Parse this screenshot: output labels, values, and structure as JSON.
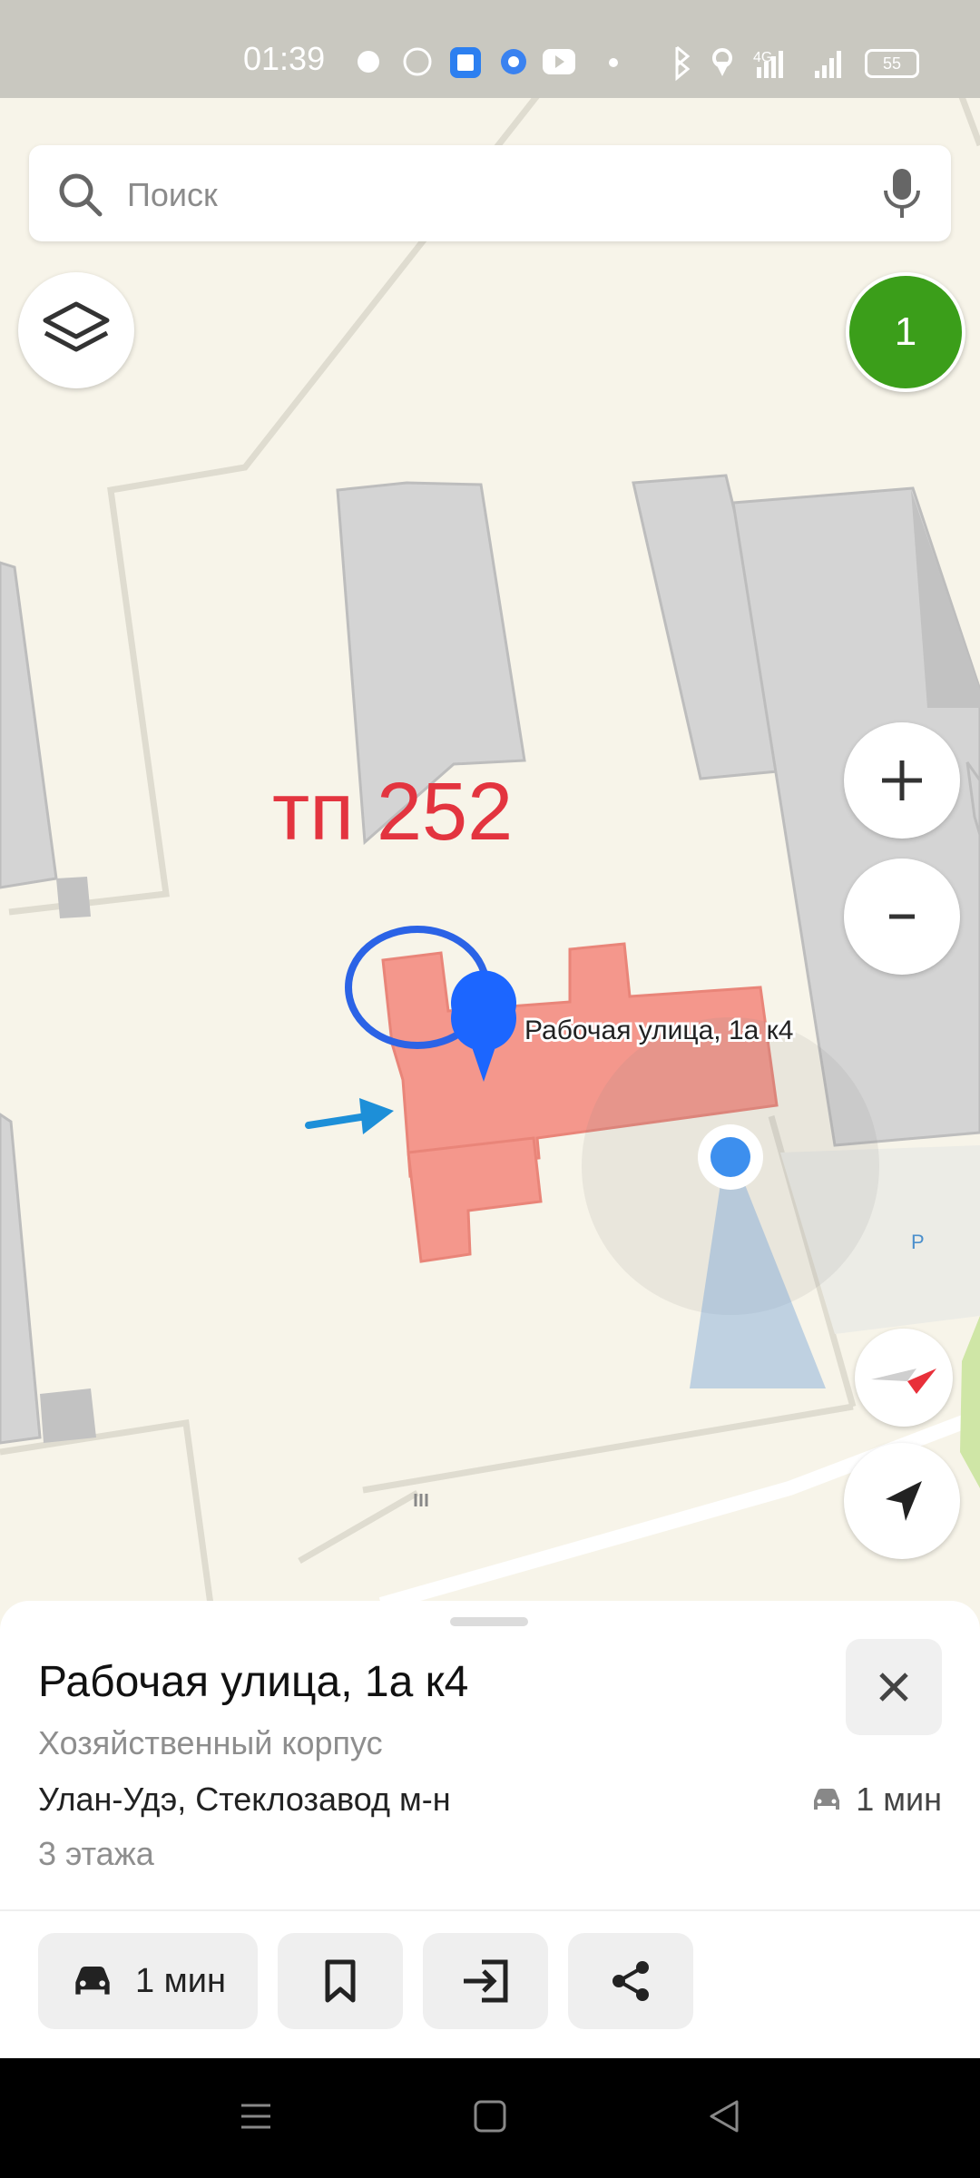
{
  "status_bar": {
    "time": "01:39",
    "network": "4G",
    "battery": "55"
  },
  "search": {
    "placeholder": "Поиск"
  },
  "notification_badge": "1",
  "map": {
    "annotation_text": "тп 252",
    "pin_label": "Рабочая улица, 1а к4",
    "parking_label": "P",
    "colors": {
      "selected_building": "#f4978c",
      "building": "#d4d4d4",
      "pin": "#1c66ff",
      "annotation": "#e3343f"
    }
  },
  "sheet": {
    "title": "Рабочая улица, 1а к4",
    "subtitle": "Хозяйственный корпус",
    "address": "Улан-Удэ, Стеклозавод м-н",
    "eta": "1 мин",
    "floors": "3 этажа",
    "route_button_label": "1 мин"
  },
  "icons": [
    "search-icon",
    "microphone-icon",
    "layers-icon",
    "zoom-in-icon",
    "zoom-out-icon",
    "compass-icon",
    "my-location-icon",
    "close-icon",
    "car-icon",
    "bookmark-icon",
    "login-icon",
    "share-icon"
  ]
}
